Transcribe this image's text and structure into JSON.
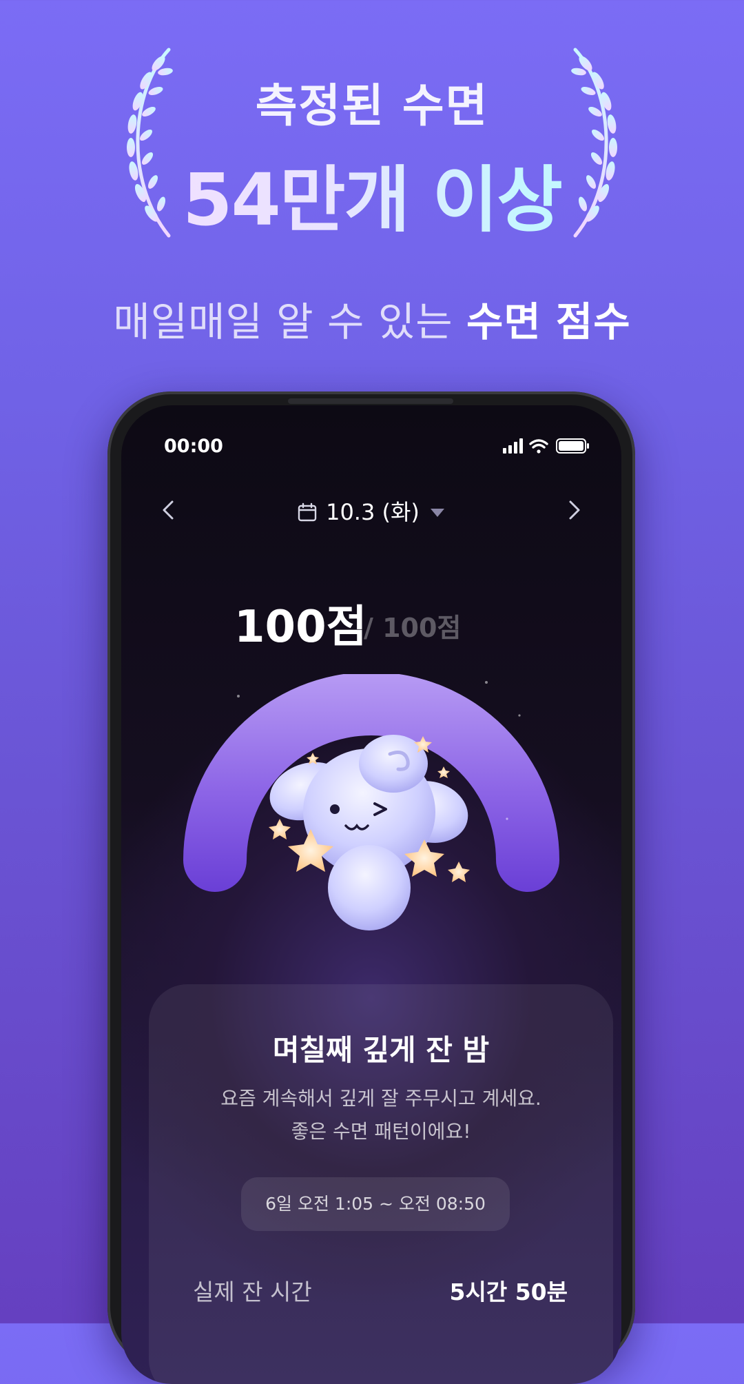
{
  "hero": {
    "title": "측정된 수면",
    "count": "54만개 이상",
    "tagline_prefix": "매일매일 알 수 있는 ",
    "tagline_emphasis": "수면 점수"
  },
  "status_bar": {
    "time": "00:00",
    "icons": [
      "signal-icon",
      "wifi-icon",
      "battery-icon"
    ]
  },
  "date_nav": {
    "date": "10.3 (화)",
    "icons": [
      "chevron-left-icon",
      "calendar-icon",
      "dropdown-triangle-icon",
      "chevron-right-icon"
    ]
  },
  "score": {
    "value": "100점",
    "total": "/ 100점"
  },
  "card": {
    "title": "며칠째 깊게 잔 밤",
    "desc_line1": "요즘 계속해서 깊게 잘 주무시고 계세요.",
    "desc_line2": "좋은 수면 패턴이에요!",
    "time_range": "6일 오전 1:05 ~ 오전 08:50",
    "row_label": "실제 잔 시간",
    "row_value": "5시간 50분"
  },
  "colors": {
    "background_top": "#7b6cf5",
    "background_bottom": "#6540c0",
    "arch_top": "#b79bf4",
    "arch_bottom": "#6a3fd6",
    "mascot": "#dcdcff",
    "star": "#ffd9a8"
  }
}
